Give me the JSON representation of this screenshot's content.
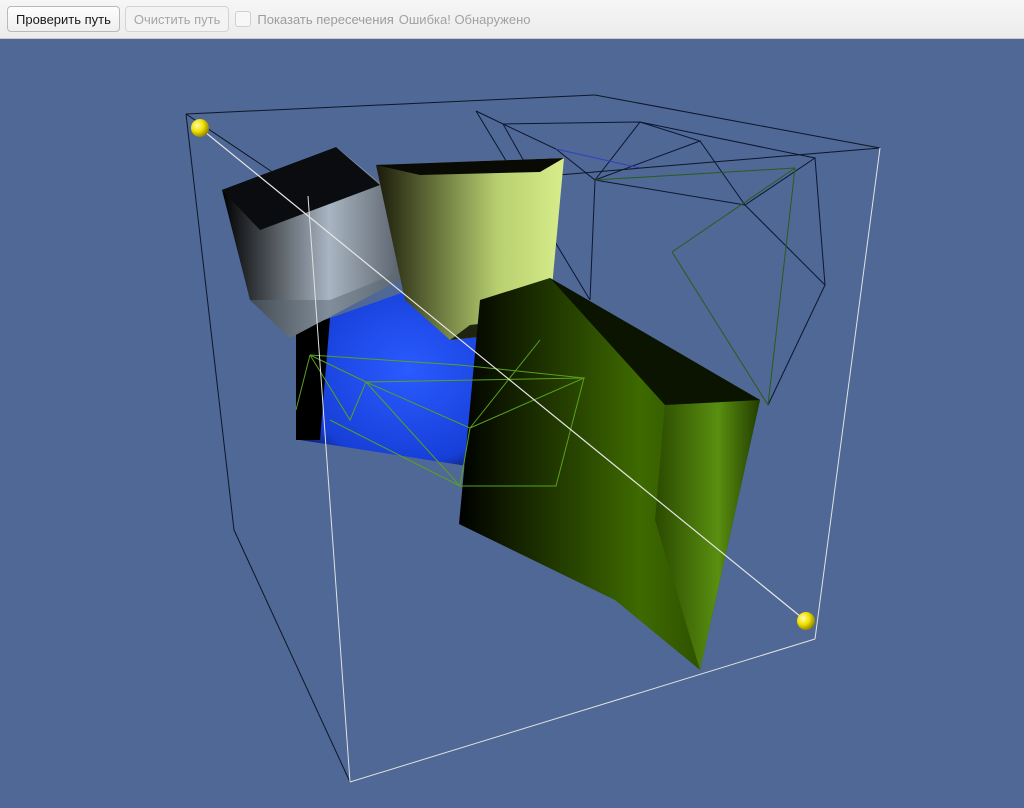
{
  "toolbar": {
    "check_path_label": "Проверить путь",
    "clear_path_label": "Очистить путь",
    "show_intersections_label": "Показать пересечения",
    "status_text": "Ошибка! Обнаружено"
  },
  "colors": {
    "background": "#4f6896",
    "blue_solid": "#1b4bff",
    "green_solid": "#4a7c00",
    "yellow_solid": "#c9df79",
    "grey_solid": "#8d9aa8",
    "path_endpoint": "#f0e000"
  }
}
